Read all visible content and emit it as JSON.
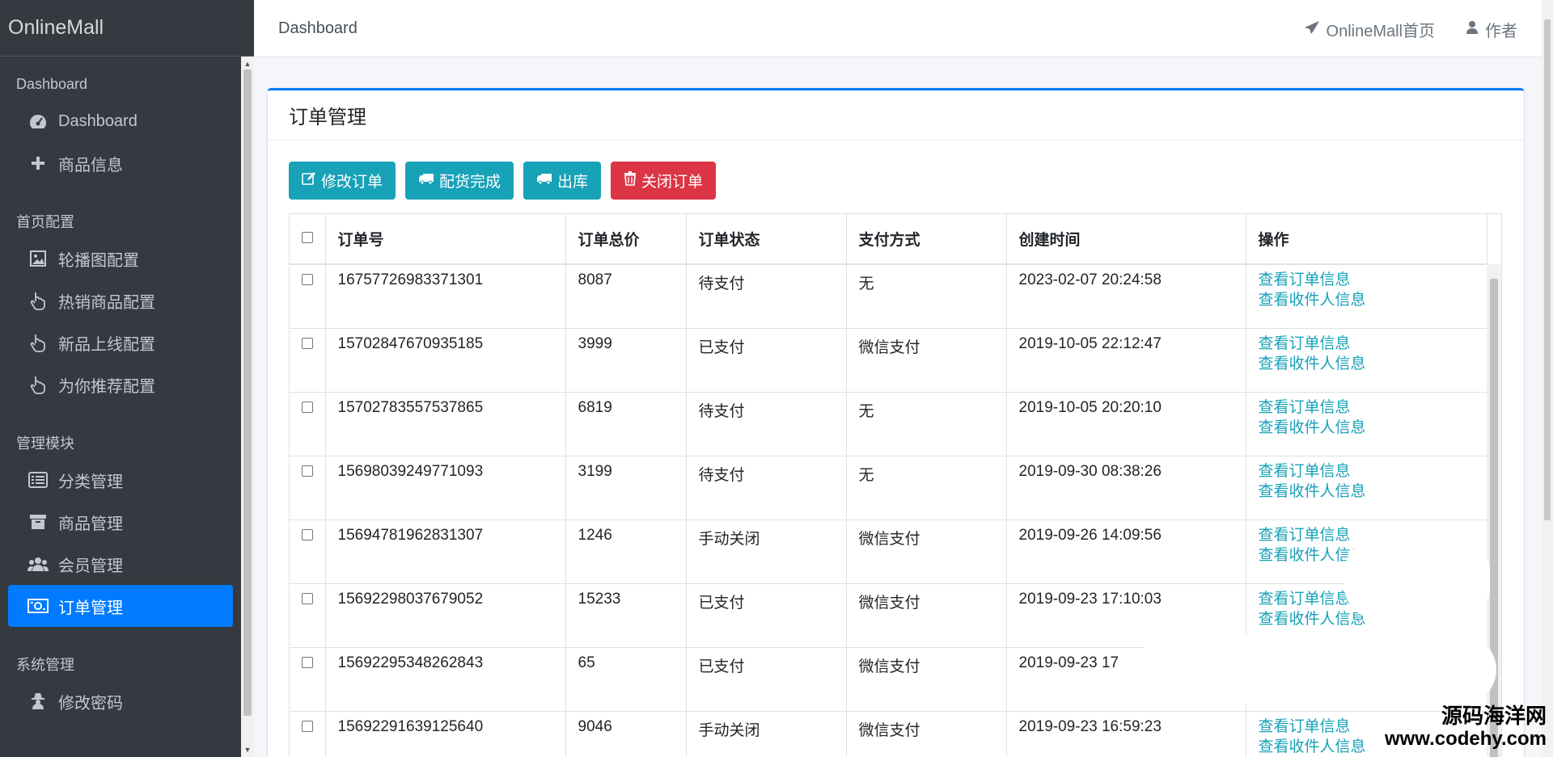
{
  "app": {
    "brand": "OnlineMall"
  },
  "sidebar": {
    "sections": [
      {
        "header": "Dashboard",
        "items": [
          {
            "label": "Dashboard",
            "icon": "tachometer-icon"
          },
          {
            "label": "商品信息",
            "icon": "plus-icon"
          }
        ]
      },
      {
        "header": "首页配置",
        "items": [
          {
            "label": "轮播图配置",
            "icon": "image-icon"
          },
          {
            "label": "热销商品配置",
            "icon": "hand-pointer-icon"
          },
          {
            "label": "新品上线配置",
            "icon": "hand-pointer-icon"
          },
          {
            "label": "为你推荐配置",
            "icon": "hand-pointer-icon"
          }
        ]
      },
      {
        "header": "管理模块",
        "items": [
          {
            "label": "分类管理",
            "icon": "list-icon"
          },
          {
            "label": "商品管理",
            "icon": "archive-icon"
          },
          {
            "label": "会员管理",
            "icon": "users-icon"
          },
          {
            "label": "订单管理",
            "icon": "money-icon",
            "active": true
          }
        ]
      },
      {
        "header": "系统管理",
        "items": [
          {
            "label": "修改密码",
            "icon": "user-secret-icon"
          }
        ]
      }
    ]
  },
  "topbar": {
    "breadcrumb": "Dashboard",
    "home_link": "OnlineMall首页",
    "author_link": "作者"
  },
  "card": {
    "title": "订单管理"
  },
  "toolbar": {
    "edit": "修改订单",
    "pack": "配货完成",
    "ship": "出库",
    "close": "关闭订单"
  },
  "table": {
    "headers": [
      "订单号",
      "订单总价",
      "订单状态",
      "支付方式",
      "创建时间",
      "操作"
    ],
    "op_view_order": "查看订单信息",
    "op_view_receiver": "查看收件人信息",
    "rows": [
      {
        "no": "16757726983371301",
        "price": "8087",
        "status": "待支付",
        "pay": "无",
        "time": "2023-02-07 20:24:58"
      },
      {
        "no": "15702847670935185",
        "price": "3999",
        "status": "已支付",
        "pay": "微信支付",
        "time": "2019-10-05 22:12:47"
      },
      {
        "no": "15702783557537865",
        "price": "6819",
        "status": "待支付",
        "pay": "无",
        "time": "2019-10-05 20:20:10"
      },
      {
        "no": "15698039249771093",
        "price": "3199",
        "status": "待支付",
        "pay": "无",
        "time": "2019-09-30 08:38:26"
      },
      {
        "no": "15694781962831307",
        "price": "1246",
        "status": "手动关闭",
        "pay": "微信支付",
        "time": "2019-09-26 14:09:56"
      },
      {
        "no": "15692298037679052",
        "price": "15233",
        "status": "已支付",
        "pay": "微信支付",
        "time": "2019-09-23 17:10:03"
      },
      {
        "no": "15692295348262843",
        "price": "65",
        "status": "已支付",
        "pay": "微信支付",
        "time": "2019-09-23 17"
      },
      {
        "no": "15692291639125640",
        "price": "9046",
        "status": "手动关闭",
        "pay": "微信支付",
        "time": "2019-09-23 16:59:23"
      }
    ]
  },
  "watermark": {
    "line1": "源码海洋网",
    "line2": "www.codehy.com"
  },
  "colors": {
    "sidebar_bg": "#343a40",
    "active": "#007bff",
    "info": "#17a2b8",
    "danger": "#dc3545"
  }
}
